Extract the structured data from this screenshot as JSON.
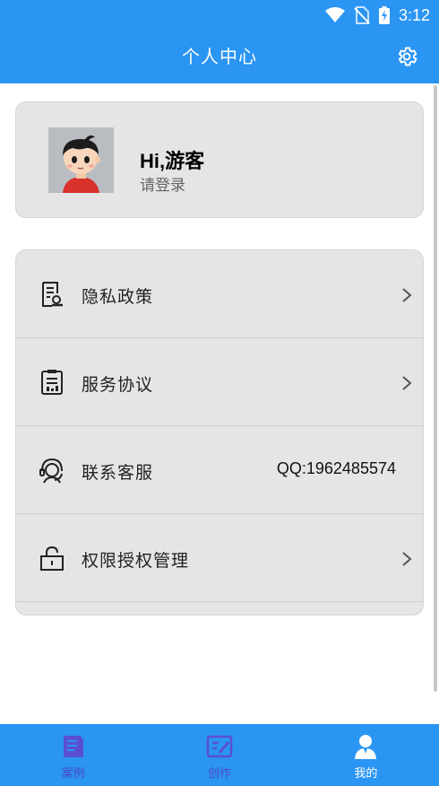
{
  "status_bar": {
    "time": "3:12",
    "icons": [
      "wifi-icon",
      "no-sim-icon",
      "battery-charging-icon"
    ]
  },
  "header": {
    "title": "个人中心",
    "settings_icon": "gear-icon",
    "background_color": "#2a95f3"
  },
  "profile": {
    "greeting": "Hi,游客",
    "login_hint": "请登录",
    "avatar_icon": "cartoon-boy-avatar"
  },
  "menu": {
    "items": [
      {
        "label": "隐私政策",
        "icon": "document-search-icon",
        "has_chevron": true
      },
      {
        "label": "服务协议",
        "icon": "agreement-document-icon",
        "has_chevron": true
      },
      {
        "label": "联系客服",
        "icon": "customer-service-headset-icon",
        "value": "QQ:1962485574",
        "has_chevron": false
      },
      {
        "label": "权限授权管理",
        "icon": "lock-icon",
        "has_chevron": true
      }
    ]
  },
  "tabbar": {
    "active_index": 2,
    "active_color": "#ffffff",
    "inactive_color": "#4a47c9",
    "tabs": [
      {
        "label": "案例",
        "icon": "case-book-icon"
      },
      {
        "label": "创作",
        "icon": "create-edit-icon"
      },
      {
        "label": "我的",
        "icon": "user-profile-icon"
      }
    ]
  }
}
